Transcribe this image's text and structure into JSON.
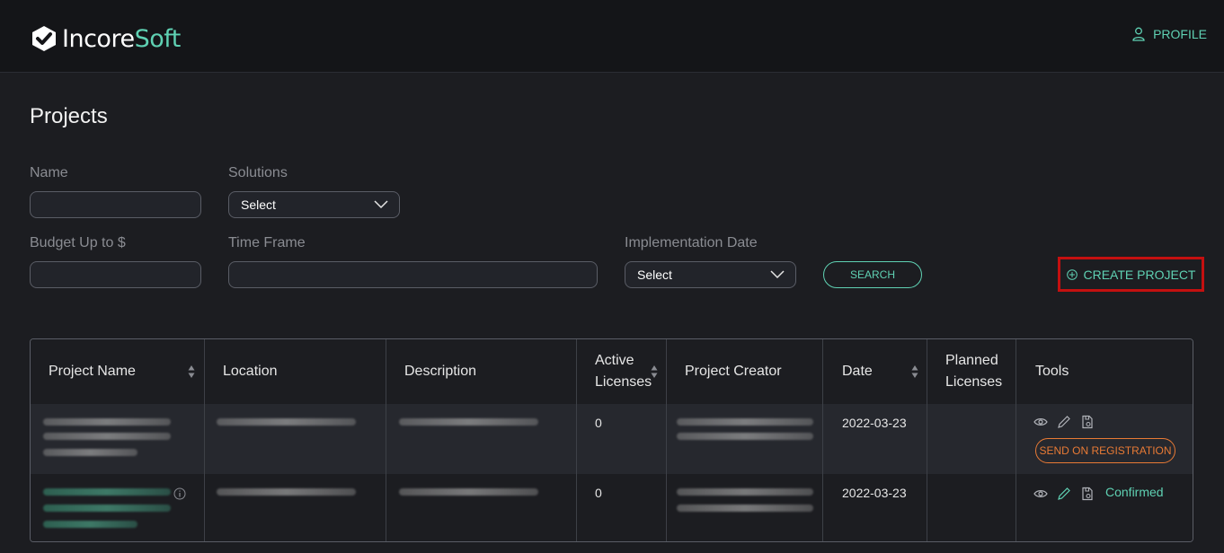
{
  "brand": {
    "name_part1": "Incore",
    "name_part2": "Soft",
    "accent": "#5fd1b3"
  },
  "header": {
    "profile_label": "PROFILE",
    "profile_icon": "user-icon"
  },
  "page": {
    "title": "Projects"
  },
  "filters": {
    "name_label": "Name",
    "name_value": "",
    "solutions_label": "Solutions",
    "solutions_value": "Select",
    "budget_label": "Budget Up to $",
    "budget_value": "",
    "timeframe_label": "Time Frame",
    "timeframe_value": "",
    "impl_date_label": "Implementation Date",
    "impl_date_value": "Select",
    "search_label": "SEARCH"
  },
  "actions": {
    "create_project_label": "CREATE PROJECT",
    "highlight_color": "#c41010"
  },
  "table": {
    "columns": {
      "project_name": "Project Name",
      "location": "Location",
      "description": "Description",
      "active_licenses_1": "Active",
      "active_licenses_2": "Licenses",
      "project_creator": "Project Creator",
      "date": "Date",
      "planned_licenses_1": "Planned",
      "planned_licenses_2": "Licenses",
      "tools": "Tools"
    },
    "rows": [
      {
        "active_licenses": "0",
        "date": "2022-03-23",
        "action_label": "SEND ON REGISTRATION"
      },
      {
        "active_licenses": "0",
        "date": "2022-03-23",
        "status_label": "Confirmed"
      }
    ]
  }
}
